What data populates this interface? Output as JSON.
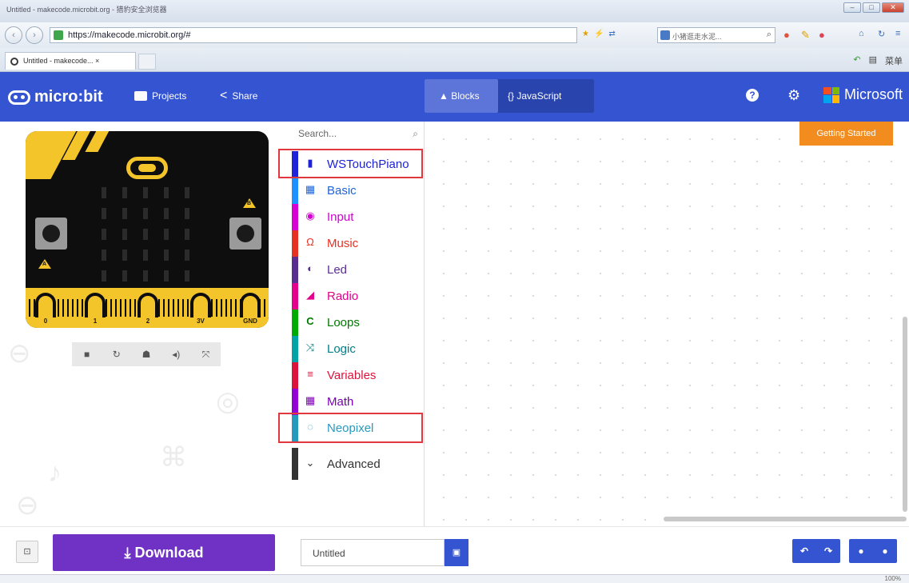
{
  "browser": {
    "window_title": "Untitled - makecode.microbit.org - 猎豹安全浏览器",
    "url": "https://makecode.microbit.org/#",
    "search_placeholder": "小猪逛走水泥...",
    "tab_title": "Untitled - makecode... ×",
    "tab_right": "菜单"
  },
  "header": {
    "logo_text": "micro:bit",
    "projects_label": "Projects",
    "share_label": "Share",
    "blocks_label": "Blocks",
    "javascript_label": "{} JavaScript",
    "brand": "Microsoft",
    "brand_colors": [
      "#f25022",
      "#7fba00",
      "#00a4ef",
      "#ffb900"
    ],
    "accent_color": "#3454d1"
  },
  "simulator": {
    "pin_labels": [
      "0",
      "1",
      "2",
      "3V",
      "GND"
    ],
    "button_a": "A",
    "button_b": "B",
    "controls": [
      "stop-icon",
      "restart-icon",
      "debug-icon",
      "sound-icon",
      "fullscreen-icon"
    ]
  },
  "toolbox": {
    "search_placeholder": "Search...",
    "categories": [
      {
        "label": "WSTouchPiano",
        "color": "#1e22d8",
        "icon": "piano-icon",
        "highlighted": true
      },
      {
        "label": "Basic",
        "color": "#1e90ff",
        "icon": "grid-icon",
        "highlighted": false
      },
      {
        "label": "Input",
        "color": "#d400d4",
        "icon": "target-icon",
        "highlighted": false
      },
      {
        "label": "Music",
        "color": "#e63022",
        "icon": "headphones-icon",
        "highlighted": false
      },
      {
        "label": "Led",
        "color": "#5c2d91",
        "icon": "toggle-icon",
        "highlighted": false
      },
      {
        "label": "Radio",
        "color": "#e3008c",
        "icon": "signal-icon",
        "highlighted": false
      },
      {
        "label": "Loops",
        "color": "#00aa00",
        "icon": "loop-icon",
        "highlighted": false
      },
      {
        "label": "Logic",
        "color": "#00a4a6",
        "icon": "shuffle-icon",
        "highlighted": false
      },
      {
        "label": "Variables",
        "color": "#dc143c",
        "icon": "list-icon",
        "highlighted": false
      },
      {
        "label": "Math",
        "color": "#9400d3",
        "icon": "calculator-icon",
        "highlighted": false
      },
      {
        "label": "Neopixel",
        "color": "#2699bf",
        "icon": "spinner-icon",
        "highlighted": true
      }
    ],
    "advanced_label": "Advanced"
  },
  "workspace": {
    "getting_started_label": "Getting Started",
    "getting_started_color": "#f28c1e"
  },
  "footer": {
    "download_label": "Download",
    "download_color": "#7032c4",
    "project_name": "Untitled"
  },
  "status": {
    "zoom": "100%"
  }
}
